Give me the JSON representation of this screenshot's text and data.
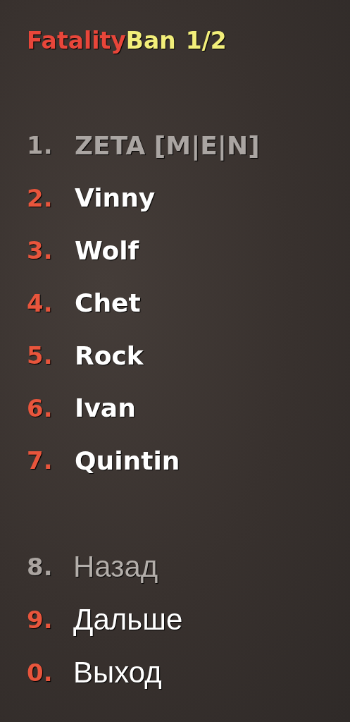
{
  "menu_title": {
    "parts": [
      {
        "text": "Fatality",
        "color": "#e8463a"
      },
      {
        "text": "Ban",
        "color": "#f2ee7a"
      }
    ],
    "page": "1/2"
  },
  "players": [
    {
      "number": "1.",
      "label": "ZETA [M|E|N]",
      "disabled": true
    },
    {
      "number": "2.",
      "label": "Vinny",
      "disabled": false
    },
    {
      "number": "3.",
      "label": "Wolf",
      "disabled": false
    },
    {
      "number": "4.",
      "label": "Chet",
      "disabled": false
    },
    {
      "number": "5.",
      "label": "Rock",
      "disabled": false
    },
    {
      "number": "6.",
      "label": "Ivan",
      "disabled": false
    },
    {
      "number": "7.",
      "label": "Quintin",
      "disabled": false
    }
  ],
  "navigation": [
    {
      "number": "8.",
      "label": "Назад",
      "disabled": true
    },
    {
      "number": "9.",
      "label": "Дальше",
      "disabled": false
    },
    {
      "number": "0.",
      "label": "Выход",
      "disabled": false
    }
  ]
}
